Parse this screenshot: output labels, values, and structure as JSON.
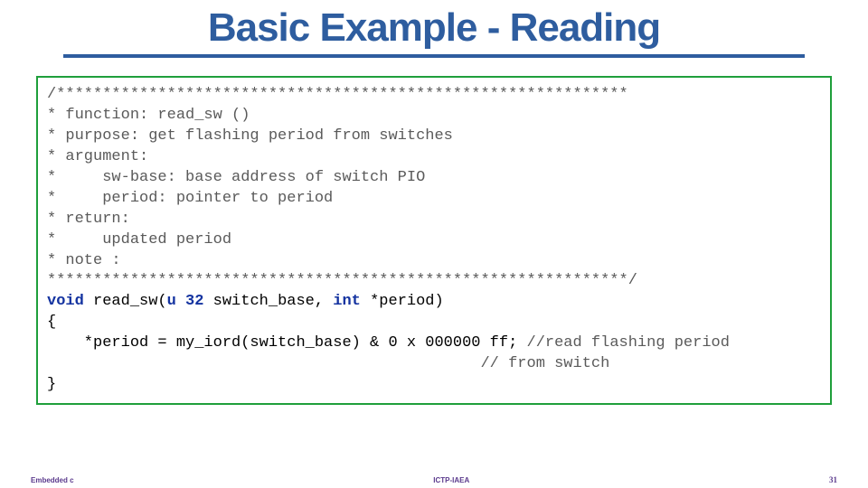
{
  "title": "Basic Example - Reading",
  "code": {
    "c1": "/**************************************************************",
    "c2": "* function: read_sw ()",
    "c3": "* purpose: get flashing period from switches",
    "c4": "* argument:",
    "c5": "*     sw-base: base address of switch PIO",
    "c6": "*     period: pointer to period",
    "c7": "* return:",
    "c8": "*     updated period",
    "c9": "* note :",
    "c10": "***************************************************************/",
    "kw_void": "void",
    "fn_name_open": " read_sw(",
    "ty_u32": "u 32",
    "sig_mid": " switch_base, ",
    "kw_int": "int",
    "sig_end": " *period)",
    "brace_open": "{",
    "body_line": "    *period = my_iord(switch_base) & 0 x 000000 ff; ",
    "body_cmt1": "//read flashing period",
    "body_indent": "                                               ",
    "body_cmt2": "// from switch",
    "brace_close": "}"
  },
  "footer": {
    "left": "Embedded c",
    "center": "ICTP-IAEA",
    "right": "31"
  }
}
